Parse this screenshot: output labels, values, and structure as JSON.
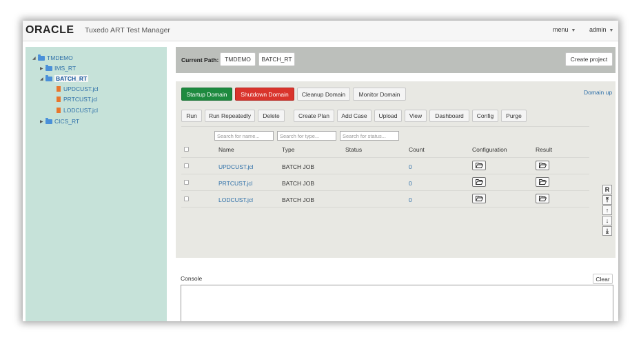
{
  "header": {
    "logo": "ORACLE",
    "title": "Tuxedo ART Test Manager",
    "menu_label": "menu",
    "user_label": "admin"
  },
  "sidebar": {
    "tree": [
      {
        "label": "TMDEMO",
        "type": "folder",
        "expanded": true
      },
      {
        "label": "IMS_RT",
        "type": "folder",
        "expanded": false
      },
      {
        "label": "BATCH_RT",
        "type": "folder",
        "expanded": true,
        "selected": true
      },
      {
        "label": "UPDCUST.jcl",
        "type": "file"
      },
      {
        "label": "PRTCUST.jcl",
        "type": "file"
      },
      {
        "label": "LODCUST.jcl",
        "type": "file"
      },
      {
        "label": "CICS_RT",
        "type": "folder",
        "expanded": false
      }
    ]
  },
  "path": {
    "label": "Current Path:",
    "crumbs": [
      "TMDEMO",
      "BATCH_RT"
    ],
    "create_project": "Create project"
  },
  "domain": {
    "startup": "Startup Domain",
    "shutdown": "Shutdown Domain",
    "cleanup": "Cleanup Domain",
    "monitor": "Monitor Domain",
    "status": "Domain up"
  },
  "toolbar": [
    "Run",
    "Run Repeatedly",
    "Delete",
    "Create Plan",
    "Add Case",
    "Upload",
    "View",
    "Dashboard",
    "Config",
    "Purge"
  ],
  "search": {
    "name_placeholder": "Search for name...",
    "type_placeholder": "Search for type...",
    "status_placeholder": "Search for status..."
  },
  "table": {
    "columns": [
      "Name",
      "Type",
      "Status",
      "Count",
      "Configuration",
      "Result"
    ],
    "rows": [
      {
        "name": "UPDCUST.jcl",
        "type": "BATCH JOB",
        "status": "",
        "count": "0"
      },
      {
        "name": "PRTCUST.jcl",
        "type": "BATCH JOB",
        "status": "",
        "count": "0"
      },
      {
        "name": "LODCUST.jcl",
        "type": "BATCH JOB",
        "status": "",
        "count": "0"
      }
    ]
  },
  "side_controls": [
    "R",
    "⤒",
    "↑",
    "↓",
    "⤓"
  ],
  "console": {
    "label": "Console",
    "clear": "Clear"
  },
  "colors": {
    "sidebar_bg": "#c6e2d9",
    "startup_green": "#1e8a3f",
    "shutdown_red": "#d9342c",
    "link_blue": "#2d6fa8"
  },
  "icons": [
    "folder-icon",
    "file-icon",
    "folder-open-icon",
    "caret-down-icon"
  ]
}
